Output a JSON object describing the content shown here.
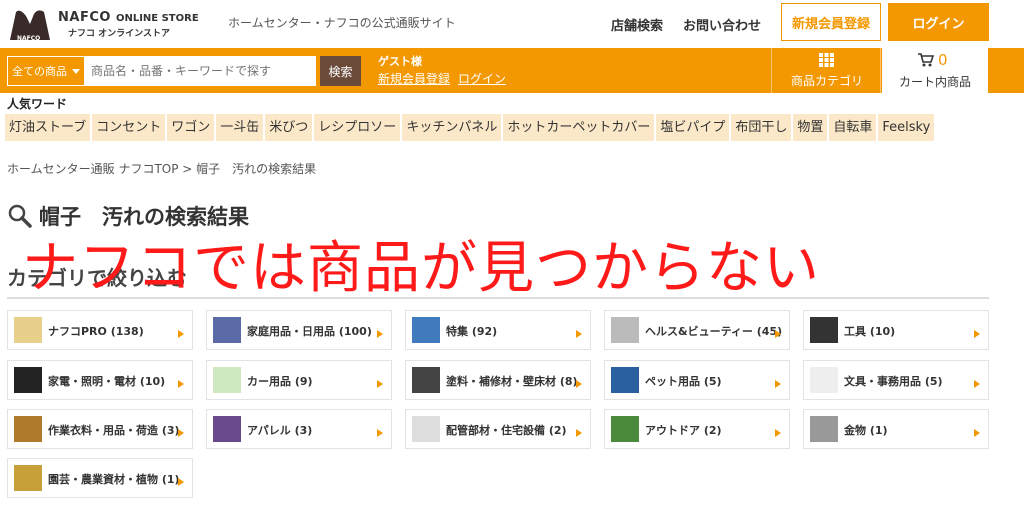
{
  "header": {
    "logo_brand": "NAFCO",
    "logo_store": "ONLINE STORE",
    "logo_sub": "ナフコ オンラインストア",
    "tagline": "ホームセンター・ナフコの公式通販サイト",
    "links": [
      "店舗検索",
      "お問い合わせ"
    ],
    "register_label": "新規会員登録",
    "login_label": "ログイン"
  },
  "searchbar": {
    "category_select": "全ての商品",
    "placeholder": "商品名・品番・キーワードで探す",
    "search_button": "検索",
    "guest_label": "ゲスト様",
    "guest_register": "新規会員登録",
    "guest_login": "ログイン",
    "category_menu": "商品カテゴリ",
    "cart_count": "0",
    "cart_label": "カート内商品"
  },
  "popular": {
    "title": "人気ワード",
    "tags": [
      "灯油ストーブ",
      "コンセント",
      "ワゴン",
      "一斗缶",
      "米びつ",
      "レシプロソー",
      "キッチンパネル",
      "ホットカーペットカバー",
      "塩ビパイプ",
      "布団干し",
      "物置",
      "自転車",
      "Feelsky"
    ]
  },
  "breadcrumb": "ホームセンター通販 ナフコTOP > 帽子　汚れの検索結果",
  "page_title": "帽子　汚れの検索結果",
  "filter_title": "カテゴリで絞り込む",
  "categories": [
    {
      "label": "ナフコPRO (138)",
      "thumb_color": "#e8d08a"
    },
    {
      "label": "家庭用品・日用品 (100)",
      "thumb_color": "#5a6ba8"
    },
    {
      "label": "特集 (92)",
      "thumb_color": "#3f7bbd"
    },
    {
      "label": "ヘルス&ビューティー (45)",
      "thumb_color": "#bbbbbb"
    },
    {
      "label": "工具 (10)",
      "thumb_color": "#333333"
    },
    {
      "label": "家電・照明・電材 (10)",
      "thumb_color": "#222222"
    },
    {
      "label": "カー用品 (9)",
      "thumb_color": "#cfe8c0"
    },
    {
      "label": "塗料・補修材・壁床材 (8)",
      "thumb_color": "#444444"
    },
    {
      "label": "ペット用品 (5)",
      "thumb_color": "#2a5fa0"
    },
    {
      "label": "文具・事務用品 (5)",
      "thumb_color": "#eeeeee"
    },
    {
      "label": "作業衣料・用品・荷造 (3)",
      "thumb_color": "#b07a2c"
    },
    {
      "label": "アパレル (3)",
      "thumb_color": "#6a4a8a"
    },
    {
      "label": "配管部材・住宅設備 (2)",
      "thumb_color": "#dddddd"
    },
    {
      "label": "アウトドア (2)",
      "thumb_color": "#4a8a3a"
    },
    {
      "label": "金物 (1)",
      "thumb_color": "#999999"
    },
    {
      "label": "園芸・農業資材・植物 (1)",
      "thumb_color": "#c8a03a"
    }
  ],
  "overlay_text": "ナフコでは商品が見つからない",
  "colors": {
    "accent": "#f39800",
    "overlay": "#ff1a1a",
    "search_btn": "#6b4a3a"
  }
}
